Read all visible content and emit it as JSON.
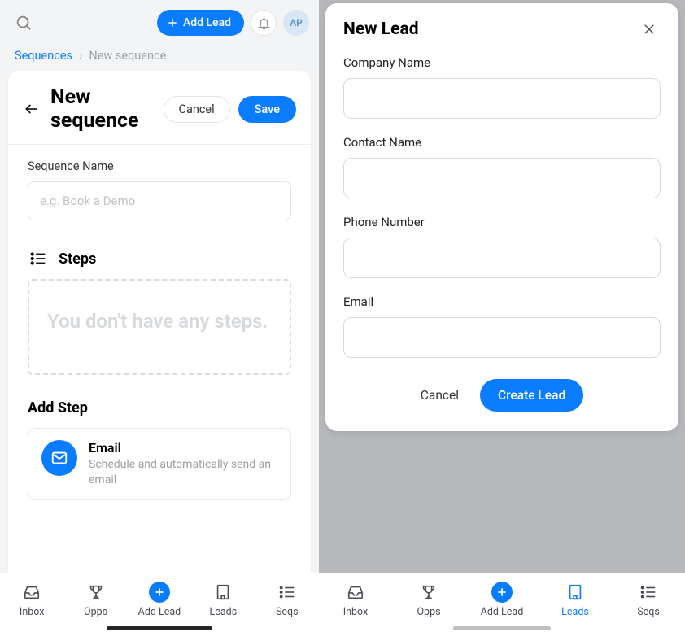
{
  "topbar": {
    "add_lead": "Add Lead",
    "avatar": "AP"
  },
  "breadcrumb": {
    "root": "Sequences",
    "current": "New sequence"
  },
  "page": {
    "title": "New sequence",
    "cancel": "Cancel",
    "save": "Save"
  },
  "sequence_name": {
    "label": "Sequence Name",
    "placeholder": "e.g. Book a Demo",
    "value": ""
  },
  "steps": {
    "heading": "Steps",
    "empty": "You don't have any steps."
  },
  "add_step": {
    "heading": "Add Step",
    "email": {
      "title": "Email",
      "desc": "Schedule and automatically send an email"
    }
  },
  "nav": {
    "inbox": "Inbox",
    "opps": "Opps",
    "add_lead": "Add Lead",
    "leads": "Leads",
    "seqs": "Seqs"
  },
  "modal": {
    "title": "New Lead",
    "company": "Company Name",
    "contact": "Contact Name",
    "phone": "Phone Number",
    "email": "Email",
    "cancel": "Cancel",
    "create": "Create Lead"
  }
}
